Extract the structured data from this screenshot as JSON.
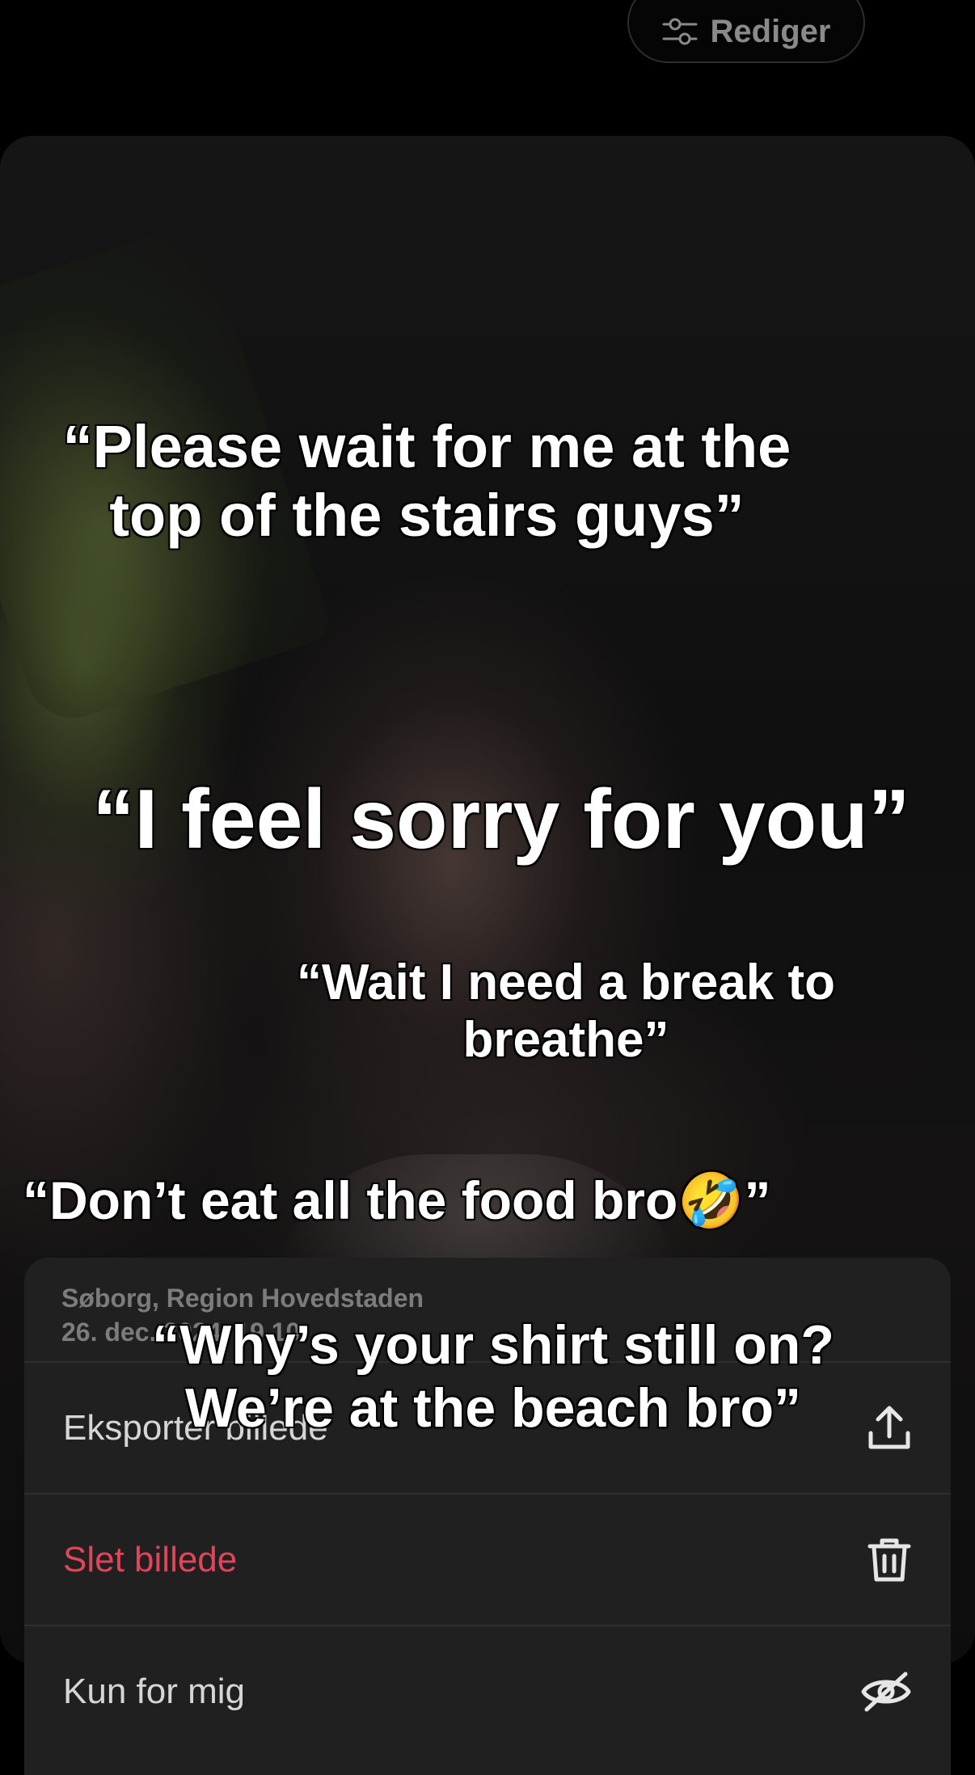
{
  "edit": {
    "label": "Rediger",
    "icon": "sliders-icon"
  },
  "captions": {
    "c1": "“Please wait for me at the\ntop of the stairs guys”",
    "c2": "“I feel sorry for you”",
    "c3": "“Wait I need a break to\nbreathe”",
    "c4": "“Don’t eat all the food bro🤣”",
    "c5": "“Why’s your shirt still on?\nWe’re at the beach bro”"
  },
  "sheet": {
    "location": "Søborg, Region Hovedstaden",
    "date": "26. dec. 2024, 19.10",
    "actions": [
      {
        "label": "Eksporter billede",
        "icon": "share-upload-icon"
      },
      {
        "label": "Slet billede",
        "icon": "trash-icon",
        "color": "#e0455a"
      },
      {
        "label": "Kun for mig",
        "icon": "eye-slash-icon"
      }
    ]
  }
}
